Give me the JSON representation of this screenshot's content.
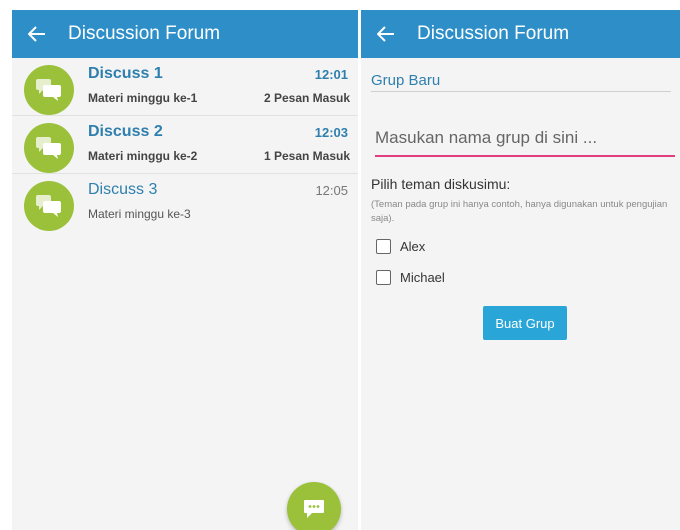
{
  "left": {
    "header": {
      "title": "Discussion Forum",
      "back_icon": "arrow-left-icon"
    },
    "threads": [
      {
        "title": "Discuss 1",
        "subtitle": "Materi minggu ke-1",
        "time": "12:01",
        "count": "2 Pesan Masuk",
        "unread": true
      },
      {
        "title": "Discuss 2",
        "subtitle": "Materi minggu ke-2",
        "time": "12:03",
        "count": "1 Pesan Masuk",
        "unread": true
      },
      {
        "title": "Discuss 3",
        "subtitle": "Materi minggu ke-3",
        "time": "12:05",
        "count": "",
        "unread": false
      }
    ],
    "fab_icon": "chat-bubble-icon"
  },
  "right": {
    "header": {
      "title": "Discussion Forum",
      "back_icon": "arrow-left-icon"
    },
    "form": {
      "heading": "Grup Baru",
      "name_placeholder": "Masukan nama grup di sini ...",
      "friends_label": "Pilih teman diskusimu:",
      "friends_note": "(Teman pada grup ini hanya contoh, hanya digunakan untuk pengujian saja).",
      "friends": [
        {
          "name": "Alex",
          "checked": false
        },
        {
          "name": "Michael",
          "checked": false
        }
      ],
      "create_button": "Buat Grup"
    }
  },
  "colors": {
    "appbar": "#2e8fc8",
    "avatar_green": "#9bc03a",
    "accent_pink": "#e0417e",
    "link_blue": "#2f7fae",
    "button_blue": "#2aa5d8"
  }
}
